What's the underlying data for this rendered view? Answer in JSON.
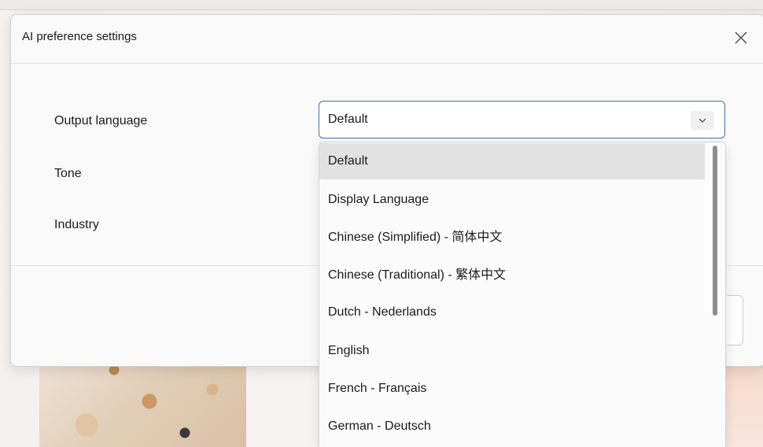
{
  "dialog": {
    "title": "AI preference settings",
    "close_icon": "close-icon"
  },
  "form": {
    "output_language_label": "Output language",
    "tone_label": "Tone",
    "industry_label": "Industry"
  },
  "select": {
    "value": "Default",
    "chevron_icon": "chevron-down-icon"
  },
  "dropdown": {
    "options": [
      {
        "label": "Default",
        "selected": true
      },
      {
        "label": "Display Language",
        "selected": false
      },
      {
        "label": "Chinese (Simplified) - 简体中文",
        "selected": false
      },
      {
        "label": "Chinese (Traditional) - 繁体中文",
        "selected": false
      },
      {
        "label": "Dutch - Nederlands",
        "selected": false
      },
      {
        "label": "English",
        "selected": false
      },
      {
        "label": "French - Français",
        "selected": false
      },
      {
        "label": "German - Deutsch",
        "selected": false
      }
    ]
  },
  "colors": {
    "accent": "#3f6fb5",
    "selected_bg": "#e2e2e2"
  }
}
